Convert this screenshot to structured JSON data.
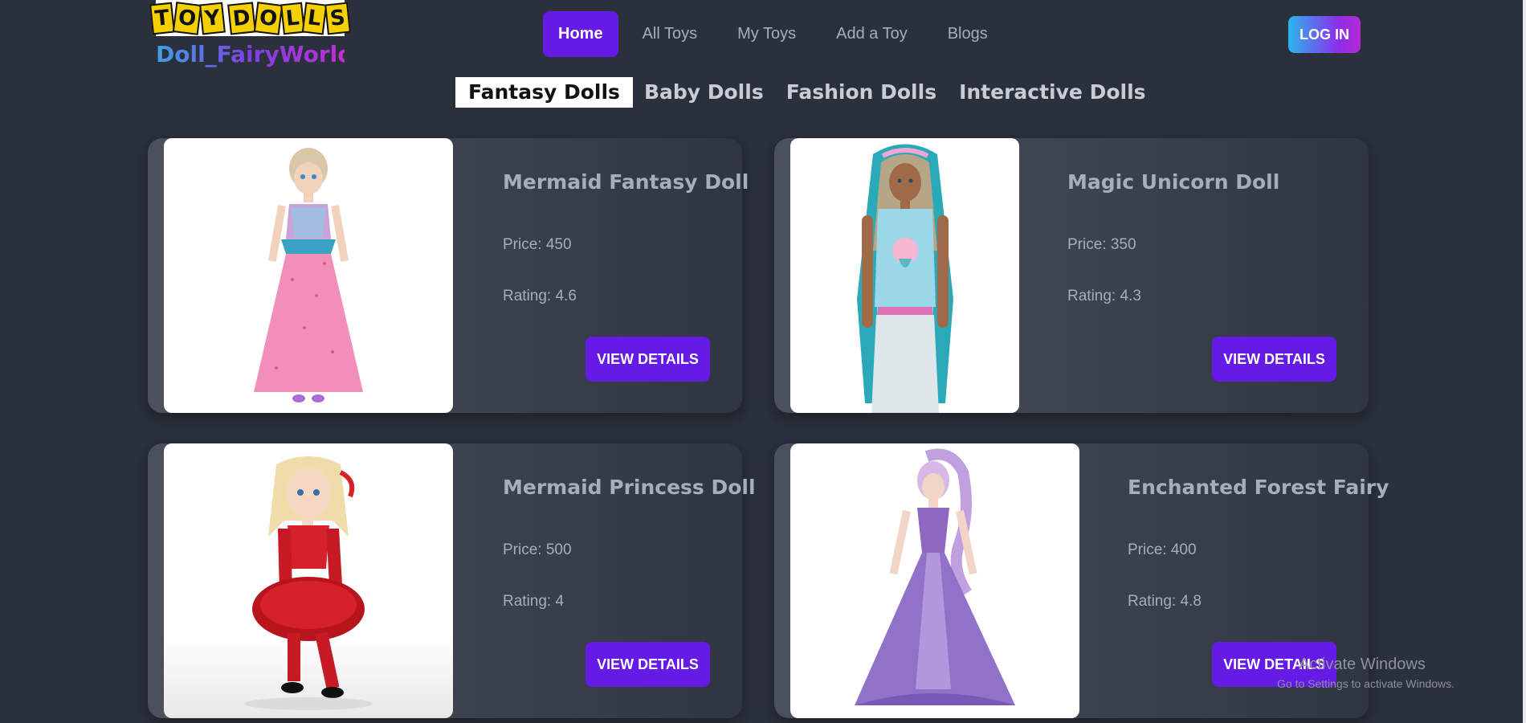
{
  "logo": {
    "letters": [
      "T",
      "O",
      "Y",
      "D",
      "O",
      "L",
      "L",
      "S"
    ],
    "subtitle": "Doll_FairyWorld"
  },
  "nav": {
    "items": [
      "Home",
      "All Toys",
      "My Toys",
      "Add a Toy",
      "Blogs"
    ],
    "active": "Home"
  },
  "login_label": "LOG IN",
  "tabs": {
    "items": [
      "Fantasy Dolls",
      "Baby Dolls",
      "Fashion Dolls",
      "Interactive Dolls"
    ],
    "active": "Fantasy Dolls"
  },
  "cards": [
    {
      "title": "Mermaid Fantasy Doll",
      "price": "Price: 450",
      "rating": "Rating: 4.6",
      "button": "VIEW DETAILS"
    },
    {
      "title": "Magic Unicorn Doll",
      "price": "Price: 350",
      "rating": "Rating: 4.3",
      "button": "VIEW DETAILS"
    },
    {
      "title": "Mermaid Princess Doll",
      "price": "Price: 500",
      "rating": "Rating: 4",
      "button": "VIEW DETAILS"
    },
    {
      "title": "Enchanted Forest Fairy",
      "price": "Price: 400",
      "rating": "Rating: 4.8",
      "button": "VIEW DETAILS"
    }
  ],
  "watermark": {
    "line1": "Activate Windows",
    "line2": "Go to Settings to activate Windows."
  },
  "colors": {
    "accent": "#661ae6",
    "background": "#2a303c",
    "logo_yellow": "#f4d000"
  }
}
